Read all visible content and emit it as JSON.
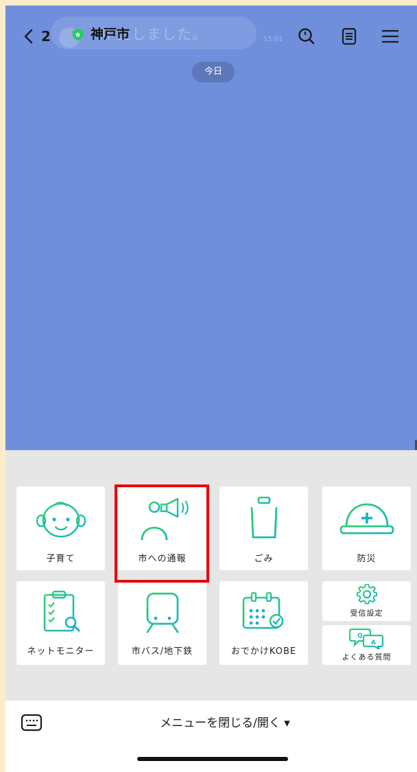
{
  "header": {
    "back_count": "2",
    "title": "神戸市",
    "notice_text": "中止しました。",
    "notice_time": "15:01"
  },
  "chat": {
    "date_badge": "今日"
  },
  "menu": {
    "tiles": [
      {
        "label": "子育て",
        "icon": "baby-face-icon"
      },
      {
        "label": "市への通報",
        "icon": "megaphone-person-icon"
      },
      {
        "label": "ごみ",
        "icon": "trash-can-icon"
      },
      {
        "label": "防災",
        "icon": "helmet-icon"
      },
      {
        "label": "ネットモニター",
        "icon": "clipboard-search-icon"
      },
      {
        "label": "市バス/地下鉄",
        "icon": "train-icon"
      },
      {
        "label": "おでかけKOBE",
        "icon": "calendar-icon"
      },
      {
        "label": "受信設定",
        "icon": "gear-icon"
      },
      {
        "label": "よくある質問",
        "icon": "qa-bubble-icon"
      }
    ]
  },
  "bottom": {
    "toggle_label": "メニューを閉じる/開く ▾"
  },
  "colors": {
    "chat_bg": "#6f8fdc",
    "menu_bg": "#e6e6e6",
    "accent_green": "#1fcf5a",
    "accent_teal": "#1ab3c4",
    "highlight": "#e8000b"
  }
}
